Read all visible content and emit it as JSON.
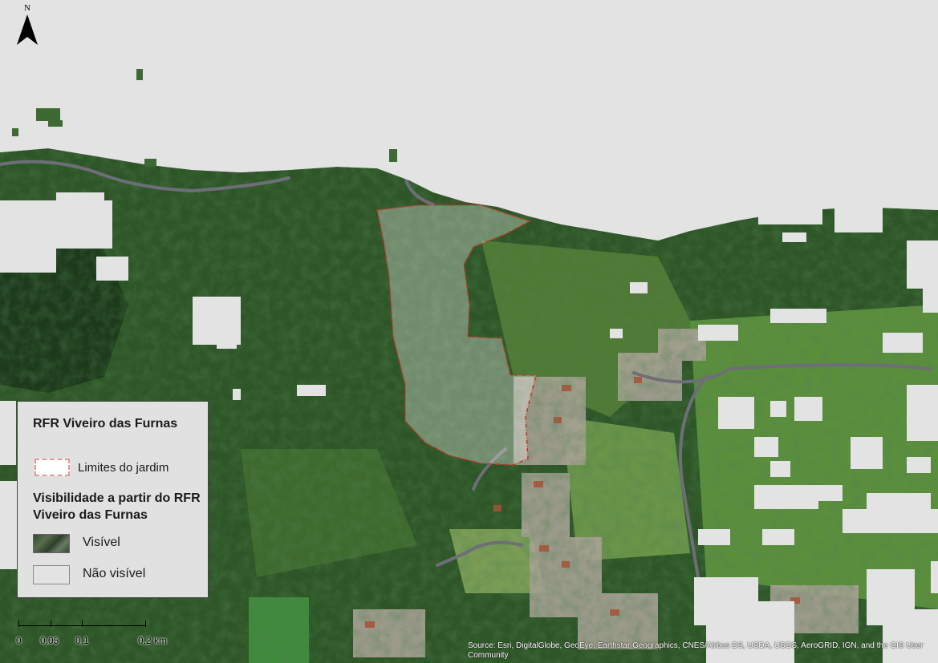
{
  "map": {
    "north_label": "N",
    "legend": {
      "title": "RFR Viveiro das Furnas",
      "garden_label": "Limites do jardim",
      "subtitle": "Visibilidade a partir do RFR Viveiro das Furnas",
      "visible_label": "Visível",
      "not_visible_label": "Não visível"
    },
    "scale_bar": {
      "ticks": [
        "0",
        "0,05",
        "0,1",
        "0,2 km"
      ]
    },
    "credits": "Source: Esri, DigitalGlobe, GeoEye, Earthstar Geographics, CNES/Airbus DS, USDA, USGS, AeroGRID, IGN, and the GIS User Community",
    "colors": {
      "not_visible": "#e3e3e3",
      "forest": "#2f5a2a",
      "pasture": "#5f8f3e",
      "garden_boundary": "#c0392b",
      "road": "#6e6e78"
    },
    "icons": [
      "north-arrow-icon"
    ]
  }
}
